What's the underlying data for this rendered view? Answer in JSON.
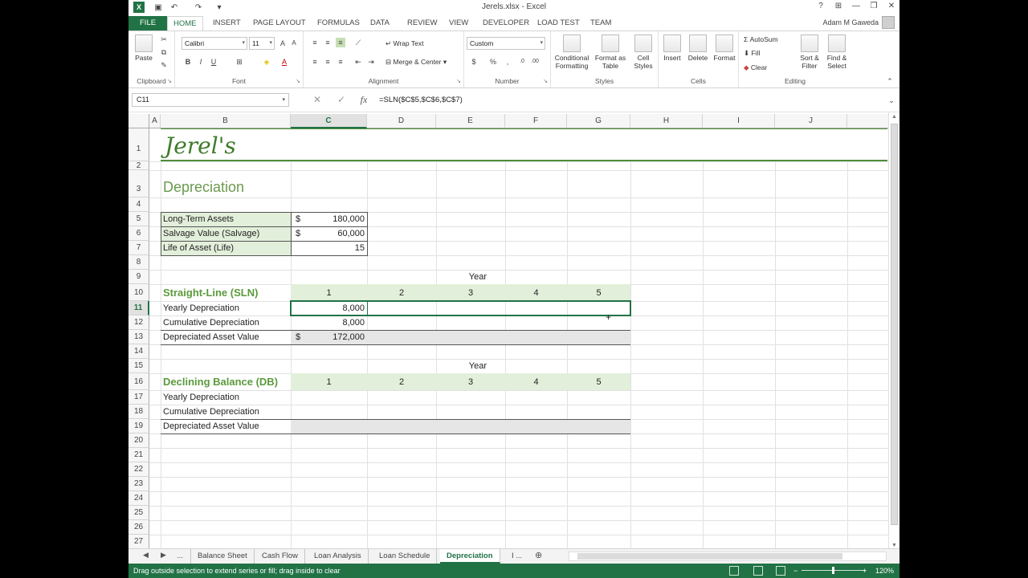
{
  "window": {
    "title": "Jerels.xlsx - Excel",
    "help": "?",
    "controls": [
      "⊞",
      "—",
      "❐",
      "✕"
    ]
  },
  "quick_access": {
    "logo": "X",
    "save": "💾",
    "undo": "↶",
    "redo": "↷",
    "customize": "▾"
  },
  "tabs": [
    "FILE",
    "HOME",
    "INSERT",
    "PAGE LAYOUT",
    "FORMULAS",
    "DATA",
    "REVIEW",
    "VIEW",
    "DEVELOPER",
    "LOAD TEST",
    "TEAM"
  ],
  "active_tab": "HOME",
  "user_name": "Adam M Gaweda",
  "ribbon": {
    "clipboard": {
      "label": "Clipboard",
      "paste": "Paste"
    },
    "font": {
      "label": "Font",
      "name": "Calibri",
      "size": "11",
      "bold": "B",
      "italic": "I",
      "underline": "U"
    },
    "alignment": {
      "label": "Alignment",
      "wrap": "Wrap Text",
      "merge": "Merge & Center"
    },
    "number": {
      "label": "Number",
      "format": "Custom",
      "currency": "$",
      "percent": "%",
      "comma": ","
    },
    "styles": {
      "label": "Styles",
      "conditional": [
        "Conditional",
        "Formatting"
      ],
      "format_table": [
        "Format as",
        "Table"
      ],
      "cell_styles": [
        "Cell",
        "Styles"
      ]
    },
    "cells": {
      "label": "Cells",
      "insert": "Insert",
      "delete": "Delete",
      "format": "Format"
    },
    "editing": {
      "label": "Editing",
      "autosum": "AutoSum",
      "fill": "Fill",
      "clear": "Clear",
      "sort": [
        "Sort &",
        "Filter"
      ],
      "find": [
        "Find &",
        "Select"
      ]
    }
  },
  "formula_bar": {
    "name_box": "C11",
    "fx": "fx",
    "formula": "=SLN($C$5,$C$6,$C$7)"
  },
  "columns": [
    "A",
    "B",
    "C",
    "D",
    "E",
    "F",
    "G",
    "H",
    "I",
    "J"
  ],
  "selected_column": "C",
  "rows": [
    "1",
    "2",
    "3",
    "4",
    "5",
    "6",
    "7",
    "8",
    "9",
    "10",
    "11",
    "12",
    "13",
    "14",
    "15",
    "16",
    "17",
    "18",
    "19",
    "20",
    "21",
    "22",
    "23",
    "24",
    "25",
    "26",
    "27"
  ],
  "selected_row": "11",
  "sheet": {
    "company": "Jerel's",
    "title": "Depreciation",
    "inputs": [
      {
        "label": "Long-Term Assets",
        "currency": "$",
        "value": "180,000"
      },
      {
        "label": "Salvage Value (Salvage)",
        "currency": "$",
        "value": "60,000"
      },
      {
        "label": "Life of Asset (Life)",
        "currency": "",
        "value": "15"
      }
    ],
    "year_label": "Year",
    "years": [
      "1",
      "2",
      "3",
      "4",
      "5"
    ],
    "sln": {
      "heading": "Straight-Line (SLN)",
      "rows": [
        {
          "label": "Yearly Depreciation",
          "currency": "",
          "value": "8,000"
        },
        {
          "label": "Cumulative Depreciation",
          "currency": "",
          "value": "8,000"
        },
        {
          "label": "Depreciated Asset Value",
          "currency": "$",
          "value": "172,000"
        }
      ]
    },
    "db": {
      "heading": "Declining Balance (DB)",
      "rows": [
        {
          "label": "Yearly Depreciation"
        },
        {
          "label": "Cumulative Depreciation"
        },
        {
          "label": "Depreciated Asset Value"
        }
      ]
    }
  },
  "sheet_tabs": [
    "...",
    "Balance Sheet",
    "Cash Flow",
    "Loan Analysis",
    "Loan Schedule",
    "Depreciation",
    "I ..."
  ],
  "active_sheet": "Depreciation",
  "status": {
    "message": "Drag outside selection to extend series or fill; drag inside to clear",
    "zoom": "120%"
  },
  "colors": {
    "excel_green": "#217346",
    "header_fill": "#e2efda",
    "total_fill": "#e6e6e6",
    "heading_text": "#5b9a3c"
  }
}
